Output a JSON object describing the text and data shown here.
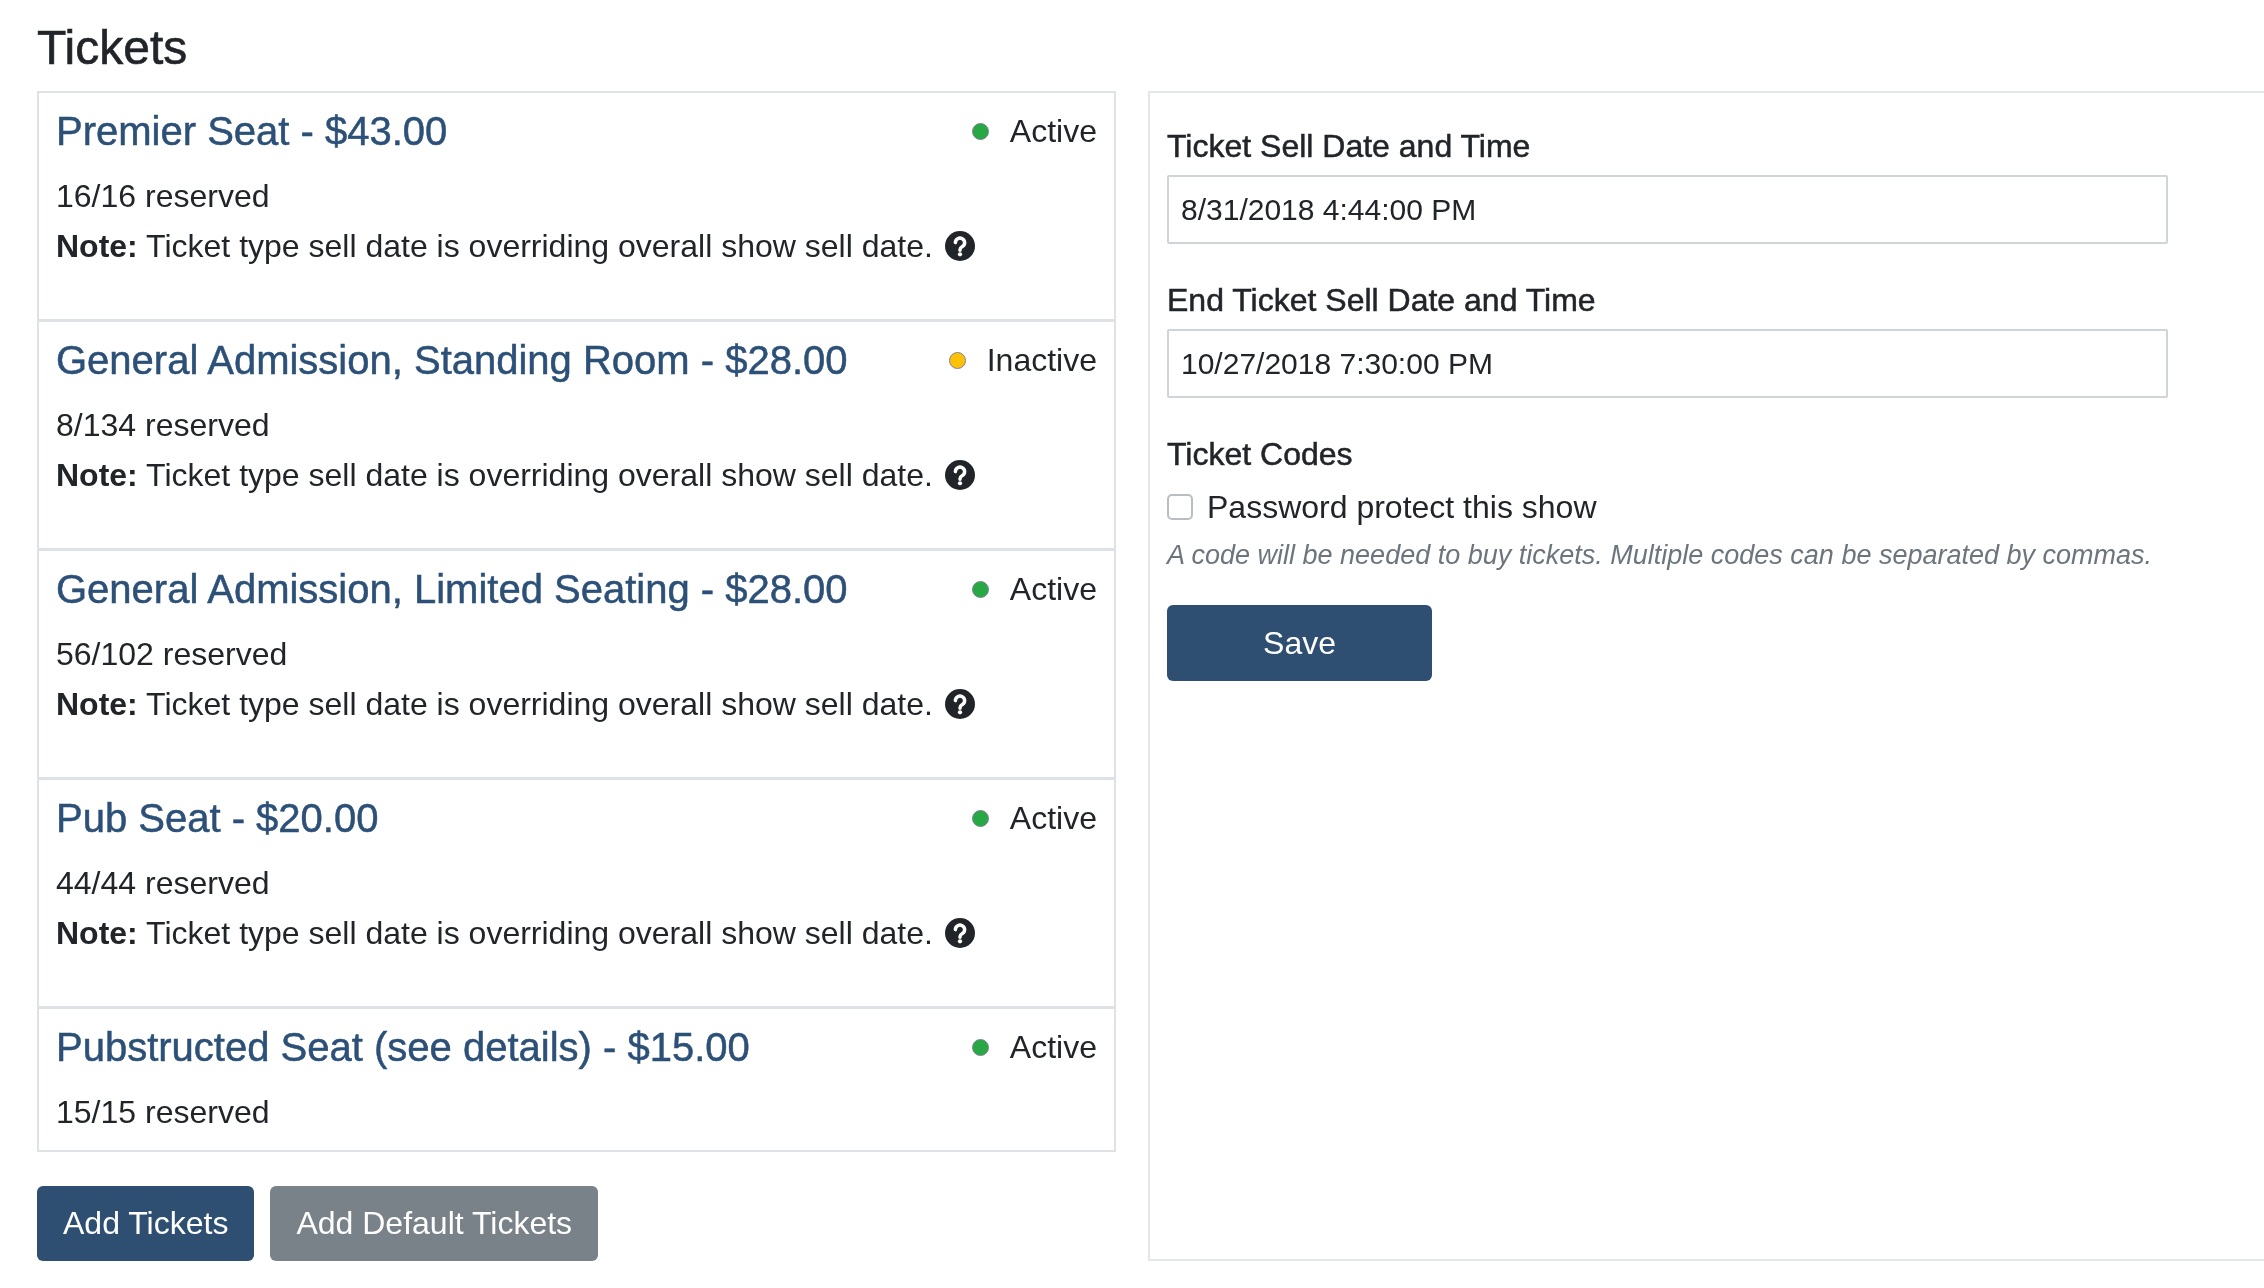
{
  "heading": "Tickets",
  "tickets": [
    {
      "title": "Premier Seat - $43.00",
      "status": "Active",
      "color": "#28a745",
      "reserved": "16/16 reserved",
      "note": "**Note:** Ticket type sell date is overriding overall show sell date."
    },
    {
      "title": "General Admission, Standing Room - $28.00",
      "status": "Inactive",
      "color": "#ffc107",
      "reserved": "8/134 reserved",
      "note": "**Note:** Ticket type sell date is overriding overall show sell date."
    },
    {
      "title": "General Admission, Limited Seating - $28.00",
      "status": "Active",
      "color": "#28a745",
      "reserved": "56/102 reserved",
      "note": "**Note:** Ticket type sell date is overriding overall show sell date."
    },
    {
      "title": "Pub Seat - $20.00",
      "status": "Active",
      "color": "#28a745",
      "reserved": "44/44 reserved",
      "note": "**Note:** Ticket type sell date is overriding overall show sell date."
    },
    {
      "title": "Pubstructed Seat (see details) - $15.00",
      "status": "Active",
      "color": "#28a745",
      "reserved": "15/15 reserved"
    }
  ],
  "actions": [
    {
      "label": "Add Tickets",
      "kind": "primary"
    },
    {
      "label": "Add Default Tickets",
      "kind": "secondary"
    }
  ],
  "sell_settings": {
    "fields": [
      {
        "label": "Ticket Sell Date and Time",
        "value": "8/31/2018 4:44:00 PM"
      },
      {
        "label": "End Ticket Sell Date and Time",
        "value": "10/27/2018 7:30:00 PM"
      }
    ],
    "ticket_codes": {
      "label": "Ticket Codes",
      "checkbox_label": "Password protect this show",
      "checked": false,
      "help": "A code will be needed to buy tickets. Multiple codes can be separated by commas."
    },
    "save_button": "Save"
  }
}
